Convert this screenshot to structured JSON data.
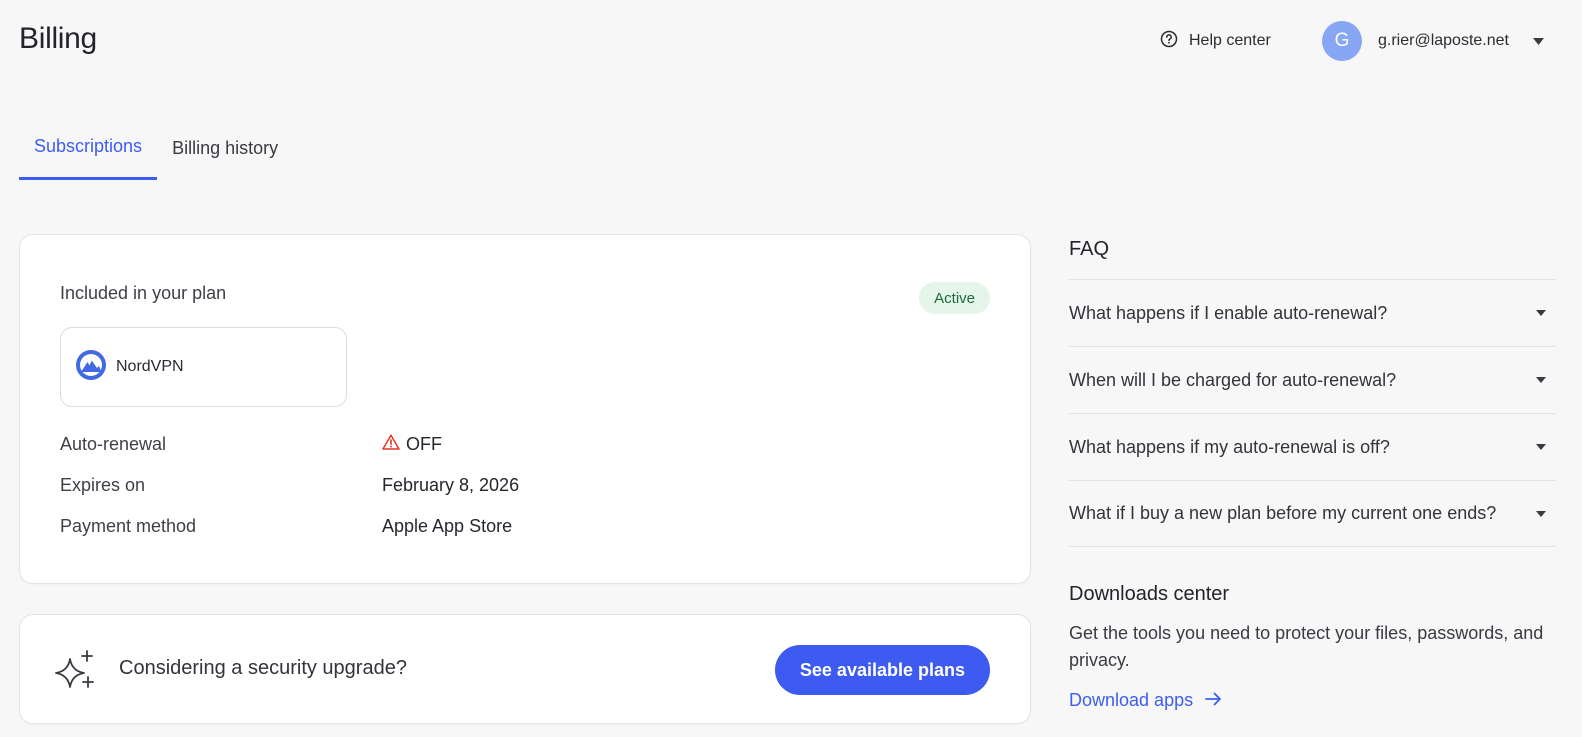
{
  "header": {
    "title": "Billing",
    "help_label": "Help center",
    "user": {
      "initial": "G",
      "email": "g.rier@laposte.net"
    }
  },
  "tabs": [
    {
      "label": "Subscriptions",
      "active": true
    },
    {
      "label": "Billing history",
      "active": false
    }
  ],
  "plan": {
    "included_label": "Included in your plan",
    "status": "Active",
    "product": "NordVPN",
    "details": [
      {
        "label": "Auto-renewal",
        "value": "OFF"
      },
      {
        "label": "Expires on",
        "value": "February 8, 2026"
      },
      {
        "label": "Payment method",
        "value": "Apple App Store"
      }
    ]
  },
  "upgrade": {
    "text": "Considering a security upgrade?",
    "button": "See available plans"
  },
  "faq": {
    "title": "FAQ",
    "items": [
      "What happens if I enable auto-renewal?",
      "When will I be charged for auto-renewal?",
      "What happens if my auto-renewal is off?",
      "What if I buy a new plan before my current one ends?"
    ]
  },
  "downloads": {
    "title": "Downloads center",
    "description": "Get the tools you need to protect your files, passwords, and privacy.",
    "link": "Download apps"
  },
  "colors": {
    "accent": "#3d5df2",
    "avatar": "#87a7f5",
    "active_badge_bg": "#e5f5ea",
    "active_badge_text": "#1d6a3a",
    "warning": "#e0362c"
  },
  "icons": [
    "question-circle-icon",
    "chevron-down-icon",
    "nordvpn-logo-icon",
    "warning-triangle-icon",
    "sparkle-icon",
    "arrow-right-icon"
  ]
}
